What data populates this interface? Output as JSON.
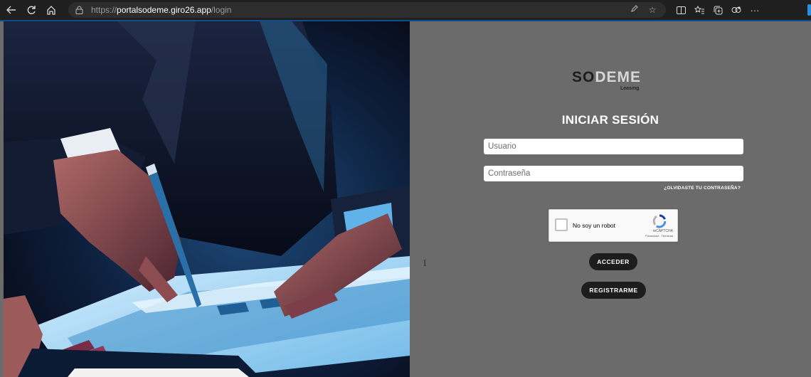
{
  "browser": {
    "url_prefix": "https://",
    "url_host": "portalsodeme.giro26.app",
    "url_path": "/login",
    "icons": {
      "back": "back-arrow-icon",
      "refresh": "refresh-icon",
      "home": "home-icon",
      "lock": "lock-icon",
      "read_aloud": "read-aloud-icon",
      "favorite": "star-icon",
      "split_screen": "split-screen-icon",
      "favorites": "favorites-icon",
      "collections": "collections-icon",
      "copilot": "copilot-icon",
      "more": "more-icon"
    },
    "more_label": "···"
  },
  "hero": {
    "description_image": "business-person-pen-charts-photo"
  },
  "login": {
    "logo_dark": "SO",
    "logo_light": "DEME",
    "logo_sub": "Leasing",
    "title": "INICIAR SESIÓN",
    "username_placeholder": "Usuario",
    "password_placeholder": "Contraseña",
    "forgot_password": "¿OLVIDASTE TU CONTRASEÑA?",
    "captcha": {
      "label": "No soy un robot",
      "brand": "reCAPTCHA",
      "links": "Privacidad - Términos"
    },
    "submit_label": "ACCEDER",
    "register_label": "REGISTRARME"
  },
  "cursor": "I",
  "colors": {
    "panel_bg": "#6b6b6b",
    "button_bg": "#1d1d1d",
    "chrome_bg": "#1f1f1f",
    "accent": "#2b8fe0"
  }
}
